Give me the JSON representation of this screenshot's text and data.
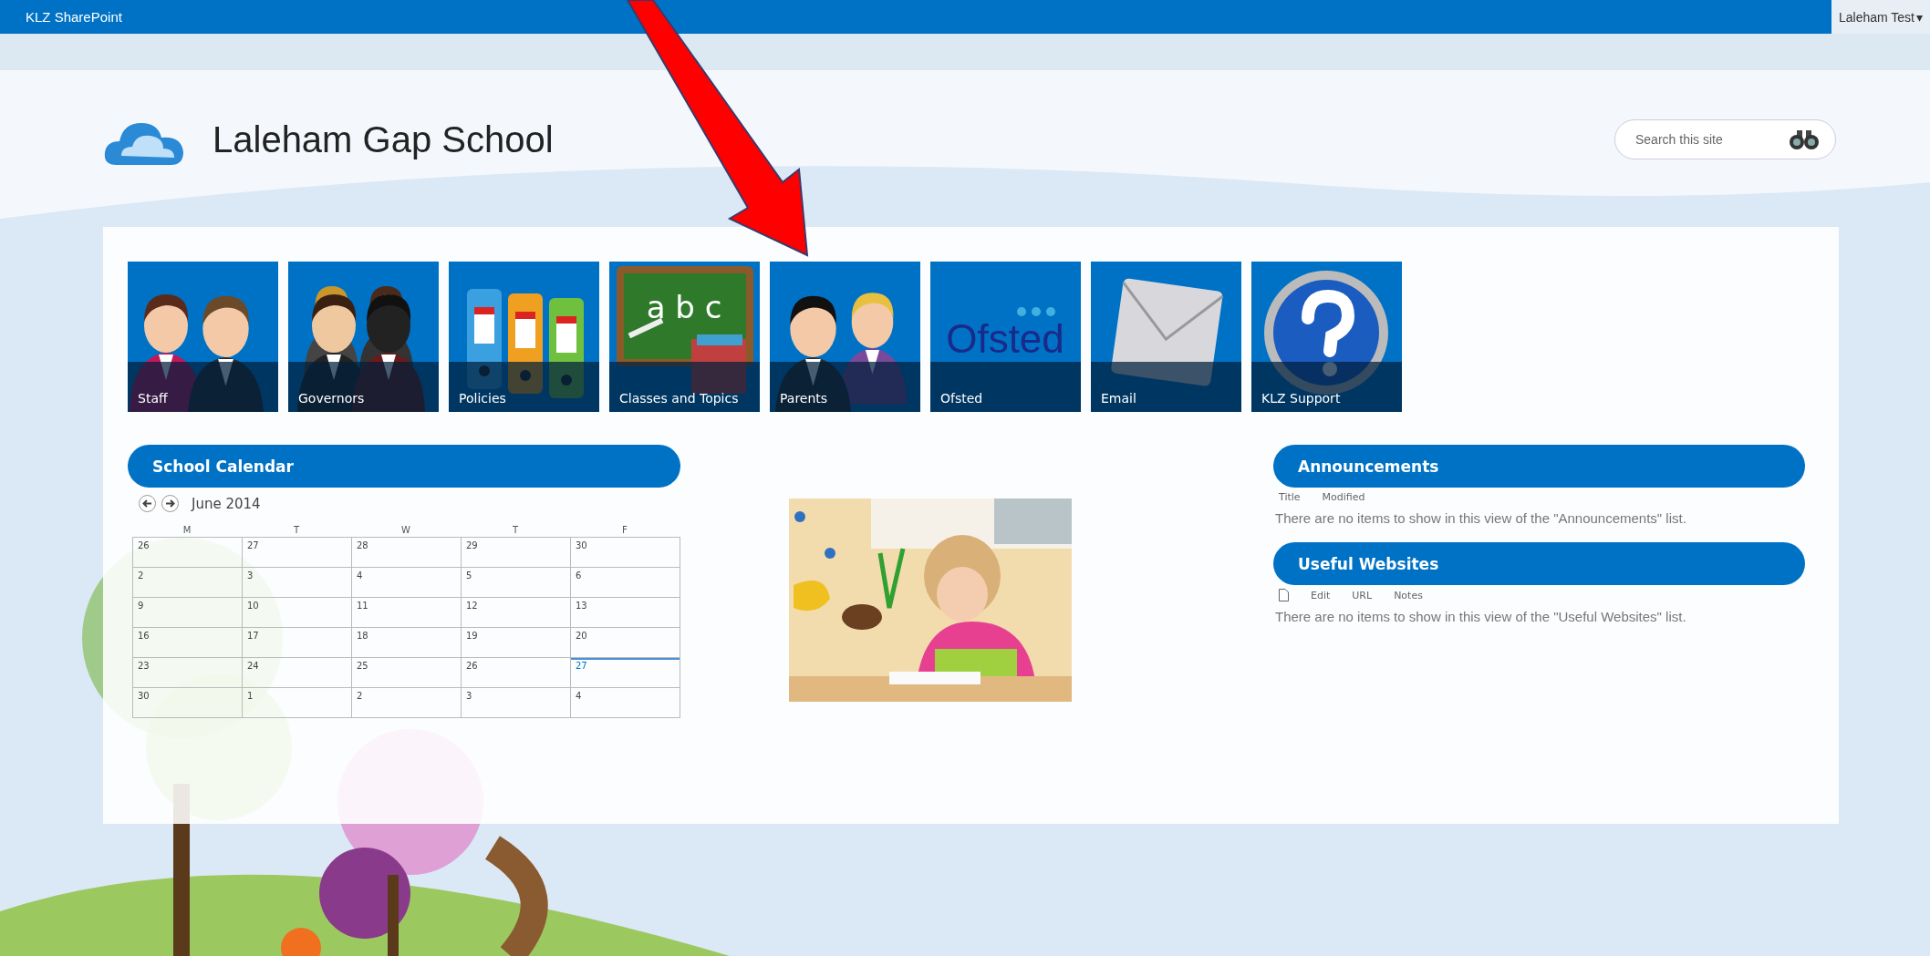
{
  "top_bar": {
    "brand": "KLZ SharePoint",
    "user": "Laleham Test",
    "user_caret": "▾"
  },
  "header": {
    "site_title": "Laleham Gap School",
    "search": {
      "placeholder": "Search this site"
    }
  },
  "tiles": [
    {
      "label": "Staff",
      "kind": "staff"
    },
    {
      "label": "Governors",
      "kind": "governors"
    },
    {
      "label": "Policies",
      "kind": "policies"
    },
    {
      "label": "Classes and Topics",
      "kind": "chalkboard",
      "board_text": "a b c"
    },
    {
      "label": "Parents",
      "kind": "parents"
    },
    {
      "label": "Ofsted",
      "kind": "logo",
      "logo_text": "Ofsted"
    },
    {
      "label": "Email",
      "kind": "envelope"
    },
    {
      "label": "KLZ Support",
      "kind": "help"
    }
  ],
  "calendar": {
    "title": "School Calendar",
    "month": "June 2014",
    "weekdays": [
      "M",
      "T",
      "W",
      "T",
      "F"
    ],
    "weeks": [
      [
        {
          "day": "26",
          "today": false
        },
        {
          "day": "27",
          "today": false
        },
        {
          "day": "28",
          "today": false
        },
        {
          "day": "29",
          "today": false
        },
        {
          "day": "30",
          "today": false
        }
      ],
      [
        {
          "day": "2",
          "today": false
        },
        {
          "day": "3",
          "today": false
        },
        {
          "day": "4",
          "today": false
        },
        {
          "day": "5",
          "today": false
        },
        {
          "day": "6",
          "today": false
        }
      ],
      [
        {
          "day": "9",
          "today": false
        },
        {
          "day": "10",
          "today": false
        },
        {
          "day": "11",
          "today": false
        },
        {
          "day": "12",
          "today": false
        },
        {
          "day": "13",
          "today": false
        }
      ],
      [
        {
          "day": "16",
          "today": false
        },
        {
          "day": "17",
          "today": false
        },
        {
          "day": "18",
          "today": false
        },
        {
          "day": "19",
          "today": false
        },
        {
          "day": "20",
          "today": false
        }
      ],
      [
        {
          "day": "23",
          "today": false
        },
        {
          "day": "24",
          "today": false
        },
        {
          "day": "25",
          "today": false
        },
        {
          "day": "26",
          "today": false
        },
        {
          "day": "27",
          "today": true
        }
      ],
      [
        {
          "day": "30",
          "today": false
        },
        {
          "day": "1",
          "today": false
        },
        {
          "day": "2",
          "today": false
        },
        {
          "day": "3",
          "today": false
        },
        {
          "day": "4",
          "today": false
        }
      ]
    ]
  },
  "lists": [
    {
      "title": "Announcements",
      "columns": [
        {
          "label": "Title",
          "kind": "text"
        },
        {
          "label": "Modified",
          "kind": "text"
        }
      ],
      "empty_message": "There are no items to show in this view of the \"Announcements\" list."
    },
    {
      "title": "Useful Websites",
      "columns": [
        {
          "kind": "doc-icon"
        },
        {
          "label": "Edit",
          "kind": "text"
        },
        {
          "label": "URL",
          "kind": "text"
        },
        {
          "label": "Notes",
          "kind": "text"
        }
      ],
      "empty_message": "There are no items to show in this view of the \"Useful Websites\" list."
    }
  ]
}
